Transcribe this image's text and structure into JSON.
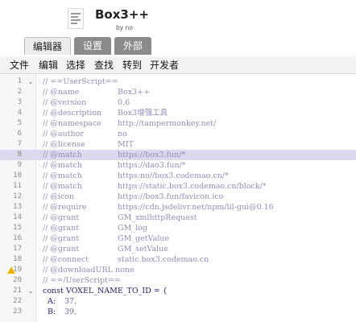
{
  "header": {
    "icon": "script-document-icon",
    "title": "Box3++",
    "author": "by no"
  },
  "tabs": [
    {
      "label": "编辑器",
      "active": true
    },
    {
      "label": "设置",
      "active": false
    },
    {
      "label": "外部",
      "active": false
    }
  ],
  "menu": [
    "文件",
    "编辑",
    "选择",
    "查找",
    "转到",
    "开发者"
  ],
  "editor": {
    "highlighted_line": 8,
    "warning_line": 19,
    "fold_lines": [
      1,
      21
    ],
    "lines": [
      {
        "num": "1",
        "key": "// ==UserScript==",
        "value": ""
      },
      {
        "num": "2",
        "key": "// @name",
        "value": "Box3++"
      },
      {
        "num": "3",
        "key": "// @version",
        "value": "0.6"
      },
      {
        "num": "4",
        "key": "// @description",
        "value": "Box3增强工具"
      },
      {
        "num": "5",
        "key": "// @namespace",
        "value": "http://tampermonkey.net/"
      },
      {
        "num": "6",
        "key": "// @author",
        "value": "no"
      },
      {
        "num": "7",
        "key": "// @license",
        "value": "MIT"
      },
      {
        "num": "8",
        "key": "// @match",
        "value": "https://box3.fun/*"
      },
      {
        "num": "9",
        "key": "// @match",
        "value": "https://dao3.fun/*"
      },
      {
        "num": "10",
        "key": "// @match",
        "value": "https:no//box3.codemao.cn/*"
      },
      {
        "num": "11",
        "key": "// @match",
        "value": "https://static.box3.codemao.cn/block/*"
      },
      {
        "num": "12",
        "key": "// @icon",
        "value": "https://box3.fun/favicon.ico"
      },
      {
        "num": "13",
        "key": "// @require",
        "value": "https://cdn.jsdelivr.net/npm/lil-gui@0.16"
      },
      {
        "num": "14",
        "key": "// @grant",
        "value": "GM_xmlhttpRequest"
      },
      {
        "num": "15",
        "key": "// @grant",
        "value": "GM_log"
      },
      {
        "num": "16",
        "key": "// @grant",
        "value": "GM_getValue"
      },
      {
        "num": "17",
        "key": "// @grant",
        "value": "GM_setValue"
      },
      {
        "num": "18",
        "key": "// @connect",
        "value": "static.box3.codemao.cn"
      },
      {
        "num": "19",
        "key": "// @downloadURL none",
        "value": ""
      },
      {
        "num": "20",
        "key": "// ==/UserScript==",
        "value": ""
      },
      {
        "num": "21",
        "key": "const VOXEL_NAME_TO_ID = {",
        "value": ""
      },
      {
        "num": "22",
        "key": "  A:",
        "value": "37,"
      },
      {
        "num": "23",
        "key": "  B:",
        "value": "39,"
      }
    ]
  },
  "colors": {
    "tab_active_bg": "#ececec",
    "tab_inactive_bg": "#8b8b8b",
    "highlight_line_bg": "#ddd8ee",
    "comment_text": "#8d8fb6",
    "code_text": "#1c1c6a",
    "warning": "#f1b400"
  }
}
